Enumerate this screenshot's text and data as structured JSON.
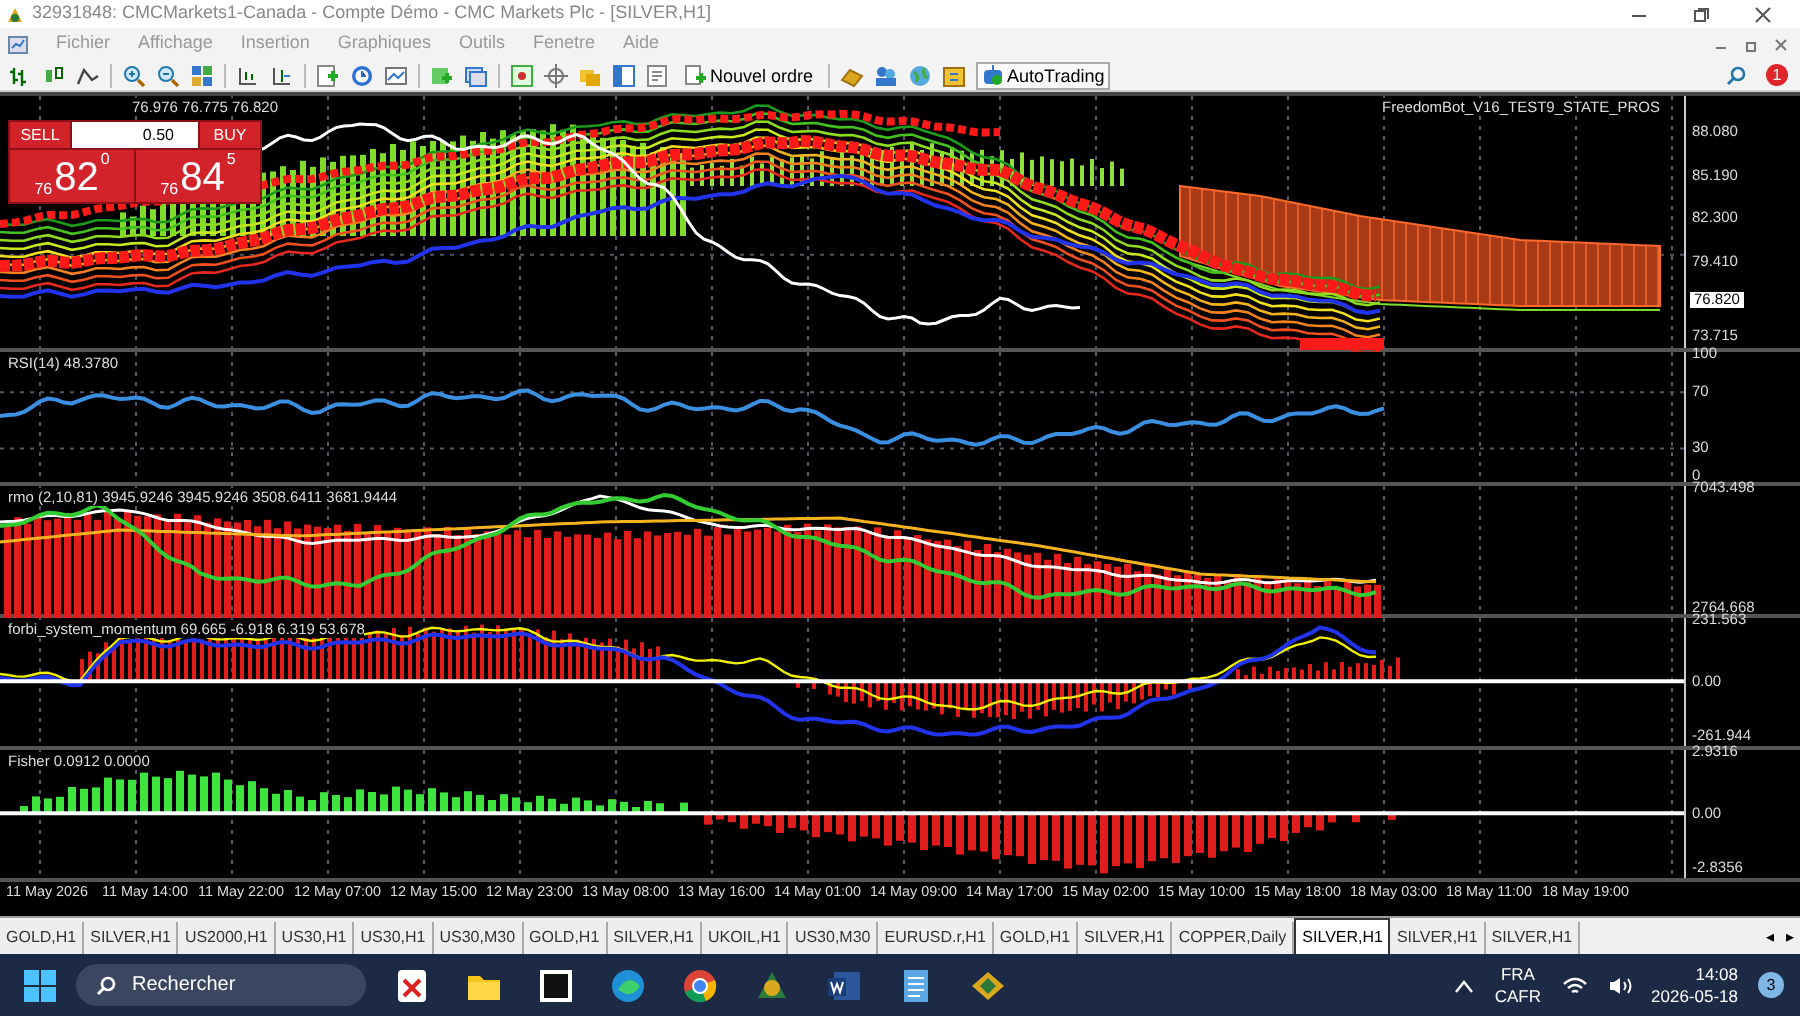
{
  "window": {
    "title": "32931848: CMCMarkets1-Canada - Compte Démo - CMC Markets Plc - [SILVER,H1]"
  },
  "menu": [
    "Fichier",
    "Affichage",
    "Insertion",
    "Graphiques",
    "Outils",
    "Fenetre",
    "Aide"
  ],
  "toolbar": {
    "new_order": "Nouvel ordre",
    "autotrading": "AutoTrading",
    "alerts_count": "1"
  },
  "chart": {
    "header": "76.976 76.775 76.820",
    "indicator_name": "FreedomBot_V16_TEST9_STATE_PROS",
    "trade_panel": {
      "sell": "SELL",
      "buy": "BUY",
      "lots": "0.50",
      "bid_prefix": "76",
      "bid_main": "82",
      "bid_suffix": "0",
      "ask_prefix": "76",
      "ask_main": "84",
      "ask_suffix": "5"
    },
    "panels": [
      {
        "kind": "price",
        "ticks": [
          "88.080",
          "85.190",
          "82.300",
          "79.410",
          "76.820",
          "73.715"
        ]
      },
      {
        "kind": "rsi",
        "label": "RSI(14) 48.3780",
        "ticks": [
          "100",
          "70",
          "30",
          "0"
        ]
      },
      {
        "kind": "rmo",
        "label": "rmo (2,10,81) 3945.9246 3945.9246 3508.6411 3681.9444",
        "ticks": [
          "7043.498",
          "2764.668"
        ]
      },
      {
        "kind": "momentum",
        "label": "forbi_system_momentum 69.665 -6.918 6.319 53.678",
        "ticks": [
          "231.563",
          "0.00",
          "-261.944"
        ]
      },
      {
        "kind": "fisher",
        "label": "Fisher 0.0912 0.0000",
        "ticks": [
          "2.9316",
          "0.00",
          "-2.8356"
        ]
      }
    ],
    "time_axis": [
      "11 May 2026",
      "11 May 14:00",
      "11 May 22:00",
      "12 May 07:00",
      "12 May 15:00",
      "12 May 23:00",
      "13 May 08:00",
      "13 May 16:00",
      "14 May 01:00",
      "14 May 09:00",
      "14 May 17:00",
      "15 May 02:00",
      "15 May 10:00",
      "15 May 18:00",
      "18 May 03:00",
      "18 May 11:00",
      "18 May 19:00"
    ]
  },
  "tabs": [
    {
      "label": "GOLD,H1",
      "selected": false
    },
    {
      "label": "SILVER,H1",
      "selected": false
    },
    {
      "label": "US2000,H1",
      "selected": false
    },
    {
      "label": "US30,H1",
      "selected": false
    },
    {
      "label": "US30,H1",
      "selected": false
    },
    {
      "label": "US30,M30",
      "selected": false
    },
    {
      "label": "GOLD,H1",
      "selected": false
    },
    {
      "label": "SILVER,H1",
      "selected": false
    },
    {
      "label": "UKOIL,H1",
      "selected": false
    },
    {
      "label": "US30,M30",
      "selected": false
    },
    {
      "label": "EURUSD.r,H1",
      "selected": false
    },
    {
      "label": "GOLD,H1",
      "selected": false
    },
    {
      "label": "SILVER,H1",
      "selected": false
    },
    {
      "label": "COPPER,Daily",
      "selected": false
    },
    {
      "label": "SILVER,H1",
      "selected": true
    },
    {
      "label": "SILVER,H1",
      "selected": false
    },
    {
      "label": "SILVER,H1",
      "selected": false
    }
  ],
  "tab_scroll": [
    "◂",
    "▸"
  ],
  "taskbar": {
    "search_placeholder": "Rechercher",
    "language": "FRA",
    "layout": "CAFR",
    "time": "14:08",
    "date": "2026-05-18",
    "notifications": "3"
  }
}
